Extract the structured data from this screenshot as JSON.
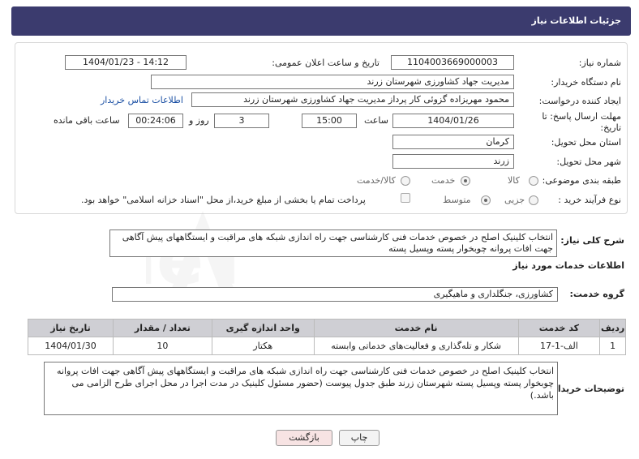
{
  "header": {
    "title": "جزئیات اطلاعات نیاز"
  },
  "form": {
    "need_number_label": "شماره نیاز:",
    "need_number": "1104003669000003",
    "announce_label": "تاریخ و ساعت اعلان عمومی:",
    "announce_value": "1404/01/23 - 14:12",
    "buyer_org_label": "نام دستگاه خریدار:",
    "buyer_org": "مدیریت جهاد کشاورزی شهرستان زرند",
    "creator_label": "ایجاد کننده درخواست:",
    "creator": "محمود مهریزاده گزوئی کار پرداز مدیریت جهاد کشاورزی شهرستان زرند",
    "contact_link": "اطلاعات تماس خریدار",
    "deadline_label": "مهلت ارسال پاسخ: تا تاریخ:",
    "deadline_date": "1404/01/26",
    "time_label": "ساعت",
    "deadline_time": "15:00",
    "days_value": "3",
    "days_label": "روز و",
    "remaining_time": "00:24:06",
    "remaining_label": "ساعت باقی مانده",
    "province_label": "استان محل تحویل:",
    "province": "کرمان",
    "city_label": "شهر محل تحویل:",
    "city": "زرند",
    "category_label": "طبقه بندی موضوعی:",
    "category_options": [
      "کالا",
      "خدمت",
      "کالا/خدمت"
    ],
    "category_selected": "خدمت",
    "process_label": "نوع فرآیند خرید :",
    "process_options": [
      "جزیی",
      "متوسط"
    ],
    "process_selected": "متوسط",
    "payment_note": "پرداخت تمام یا بخشی از مبلغ خرید،از محل \"اسناد خزانه اسلامی\" خواهد بود."
  },
  "summary": {
    "label": "شرح کلی نیاز:",
    "text": "انتخاب کلینیک اصلح در خصوص خدمات فنی کارشناسی جهت راه اندازی شبکه های مراقبت و ایستگاههای پیش آگاهی جهت  افات پروانه چوبخوار پسته  وپسیل پسته"
  },
  "services": {
    "section_title": "اطلاعات خدمات مورد نیاز",
    "group_label": "گروه خدمت:",
    "group_value": "کشاورزی، جنگلداری و ماهیگیری",
    "columns": [
      "ردیف",
      "کد خدمت",
      "نام خدمت",
      "واحد اندازه گیری",
      "تعداد / مقدار",
      "تاریخ نیاز"
    ],
    "rows": [
      [
        "1",
        "الف-1-17",
        "شکار و تله‌گذاری و فعالیت‌های خدماتی وابسته",
        "هکتار",
        "10",
        "1404/01/30"
      ]
    ]
  },
  "buyer_notes": {
    "label": "توضیحات خریدار:",
    "text": "انتخاب کلینیک اصلح در خصوص خدمات فنی کارشناسی جهت راه اندازی شبکه های مراقبت و ایستگاههای پیش آگاهی جهت  افات پروانه چوبخوار پسته  وپسیل پسته شهرستان زرند طبق جدول پیوست (حضور مسئول کلینیک در مدت اجرا در محل اجرای طرح الزامی می باشد.)"
  },
  "buttons": {
    "print": "چاپ",
    "back": "بازگشت"
  },
  "colors": {
    "header_bg": "#3b3b6e",
    "table_header_bg": "#cfcfd4",
    "link": "#1a4fa3",
    "back_btn_bg": "#f7e3e3"
  }
}
